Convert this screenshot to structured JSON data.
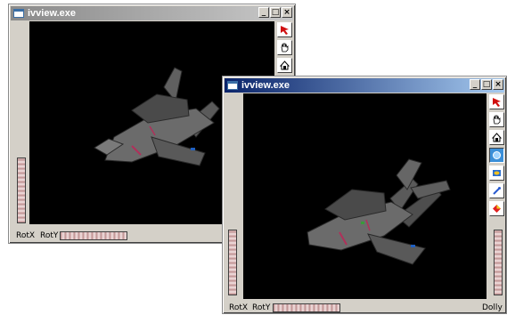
{
  "windows": [
    {
      "title": "ivview.exe",
      "active": false,
      "controls": {
        "minimize": "_",
        "maximize": "□",
        "close": "×"
      },
      "labels": {
        "rotx": "RotX",
        "roty": "RotY"
      }
    },
    {
      "title": "ivview.exe",
      "active": true,
      "controls": {
        "minimize": "_",
        "maximize": "□",
        "close": "×"
      },
      "labels": {
        "rotx": "RotX",
        "roty": "RotY",
        "dolly": "Dolly"
      }
    }
  ],
  "toolbar_icons": [
    "pick-arrow-icon",
    "hand-icon",
    "home-icon",
    "set-home-icon",
    "view-all-icon",
    "seek-icon",
    "perspective-icon"
  ],
  "colors": {
    "viewport": "#000000",
    "active_title": "#0a246a",
    "inactive_title": "#8a8a8a",
    "thumbwheel": "#d9b3b3"
  }
}
